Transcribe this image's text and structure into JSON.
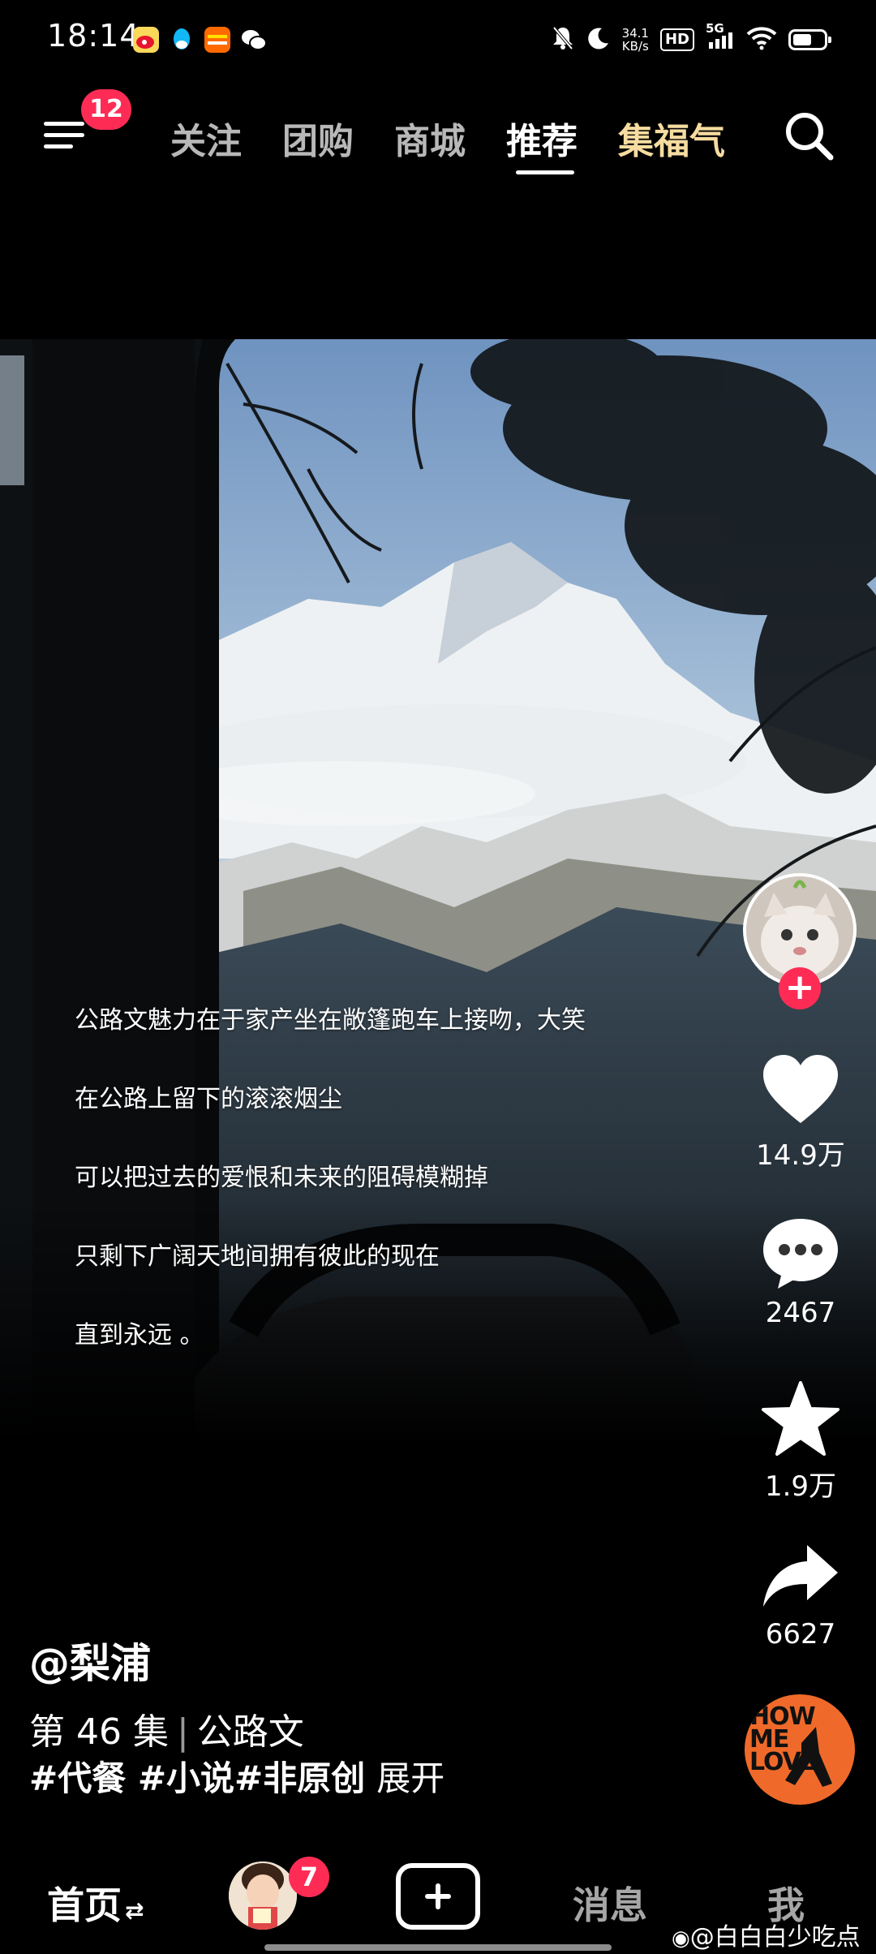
{
  "status_bar": {
    "time": "18:14",
    "network_speed_value": "34.1",
    "network_speed_unit": "KB/s",
    "hd_label": "HD",
    "cell_label": "5G",
    "battery_level": 0.6,
    "app_icons": [
      "weibo-icon",
      "qq-icon",
      "taobao-icon",
      "wechat-icon"
    ],
    "right_icons": [
      "mute-bell-icon",
      "moon-icon",
      "signal-icon",
      "wifi-icon",
      "battery-icon"
    ]
  },
  "top_nav": {
    "menu_badge": "12",
    "tabs": [
      {
        "label": "关注"
      },
      {
        "label": "团购"
      },
      {
        "label": "商城"
      },
      {
        "label": "推荐",
        "active": true
      },
      {
        "label": "集福气",
        "special": true
      }
    ],
    "active_color": "#ffffff",
    "special_color": "#f6dca0"
  },
  "video": {
    "caption_lines": [
      "公路文魅力在于家产坐在敞篷跑车上接吻，大笑",
      "在公路上留下的滚滚烟尘",
      "可以把过去的爱恨和未来的阻碍模糊掉",
      "只剩下广阔天地间拥有彼此的现在",
      "直到永远 。"
    ]
  },
  "actions": {
    "follow_label": "+",
    "likes": "14.9万",
    "comments": "2467",
    "favorites": "1.9万",
    "shares": "6627"
  },
  "post": {
    "author": "@梨浦",
    "episode": "第 46 集",
    "collection": "公路文",
    "tags": "#代餐 #小说#非原创",
    "expand_label": "展开",
    "music_disc_text": [
      "HOW",
      "ME",
      "LOVE"
    ]
  },
  "bottom_nav": {
    "home": "首页",
    "home_suffix": "⇄",
    "friend_badge": "7",
    "messages": "消息",
    "me": "我"
  },
  "watermark": "@白白白少吃点",
  "colors": {
    "accent_red": "#fe2c55",
    "background": "#000000"
  }
}
